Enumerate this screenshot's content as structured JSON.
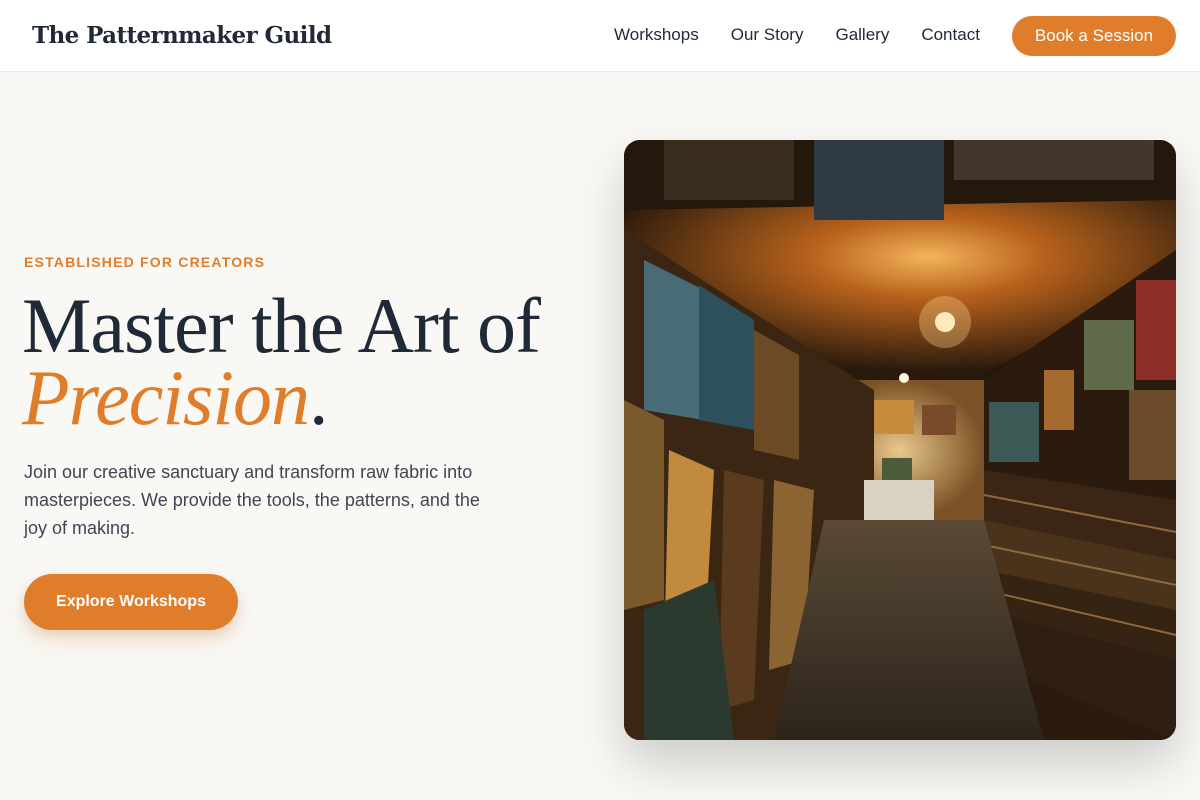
{
  "header": {
    "brand": "The Patternmaker Guild",
    "nav_items": [
      {
        "label": "Workshops"
      },
      {
        "label": "Our Story"
      },
      {
        "label": "Gallery"
      },
      {
        "label": "Contact"
      }
    ],
    "cta_label": "Book a Session"
  },
  "hero": {
    "eyebrow": "ESTABLISHED FOR CREATORS",
    "headline_line1": "Master the Art of",
    "headline_accent": "Precision",
    "headline_period": ".",
    "body": "Join our creative sanctuary and transform raw fabric into masterpieces. We provide the tools, the patterns, and the joy of making.",
    "cta_label": "Explore Workshops"
  },
  "colors": {
    "accent": "#e07d2a",
    "text_dark": "#1f2937",
    "text_body": "#3f4654",
    "background": "#f9f8f5"
  }
}
